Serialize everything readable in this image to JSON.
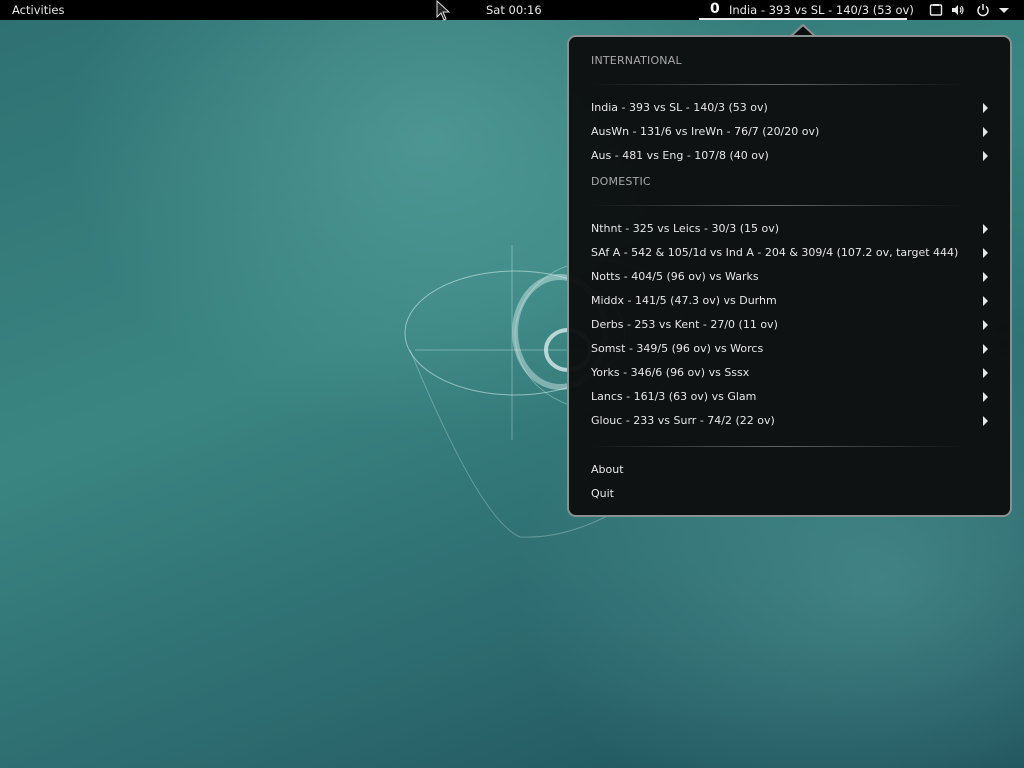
{
  "topbar": {
    "activities": "Activities",
    "clock": "Sat 00:16",
    "indicator": {
      "icon": "0",
      "score": "India - 393 vs SL - 140/3 (53 ov)"
    },
    "icons": [
      "screen-icon",
      "volume-icon",
      "power-icon",
      "chevron-down-icon"
    ]
  },
  "menu": {
    "international": {
      "header": "INTERNATIONAL",
      "items": [
        "India - 393 vs SL - 140/3 (53 ov)",
        "AusWn - 131/6 vs IreWn - 76/7 (20/20 ov)",
        "Aus - 481 vs Eng - 107/8 (40 ov)"
      ]
    },
    "domestic": {
      "header": "DOMESTIC",
      "items": [
        "Nthnt - 325 vs Leics - 30/3 (15 ov)",
        "SAf A - 542 & 105/1d vs Ind A - 204 & 309/4 (107.2 ov, target 444)",
        "Notts - 404/5 (96 ov) vs Warks",
        "Middx - 141/5 (47.3 ov) vs Durhm",
        "Derbs - 253 vs Kent - 27/0 (11 ov)",
        "Somst - 349/5 (96 ov) vs Worcs",
        "Yorks - 346/6 (96 ov) vs Sssx",
        "Lancs - 161/3 (63 ov) vs Glam",
        "Glouc - 233 vs Surr - 74/2 (22 ov)"
      ]
    },
    "about": "About",
    "quit": "Quit"
  }
}
